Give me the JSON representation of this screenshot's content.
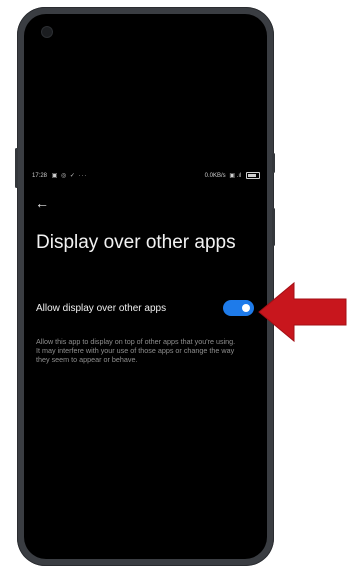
{
  "status_bar": {
    "time": "17:28",
    "left_icons": "▣ ◎ ✓ ···",
    "net_speed": "0.0KB/s",
    "right_icons": "▣ .ıl",
    "battery_label": ""
  },
  "page": {
    "back_icon": "←",
    "title": "Display over other apps"
  },
  "setting": {
    "label": "Allow display over other apps",
    "toggle_state": "on",
    "description": "Allow this app to display on top of other apps that you're using. It may interfere with your use of those apps or change the way they seem to appear or behave."
  },
  "colors": {
    "toggle_on": "#1e7bea",
    "arrow_red": "#c8161d",
    "screen_bg": "#000000"
  }
}
